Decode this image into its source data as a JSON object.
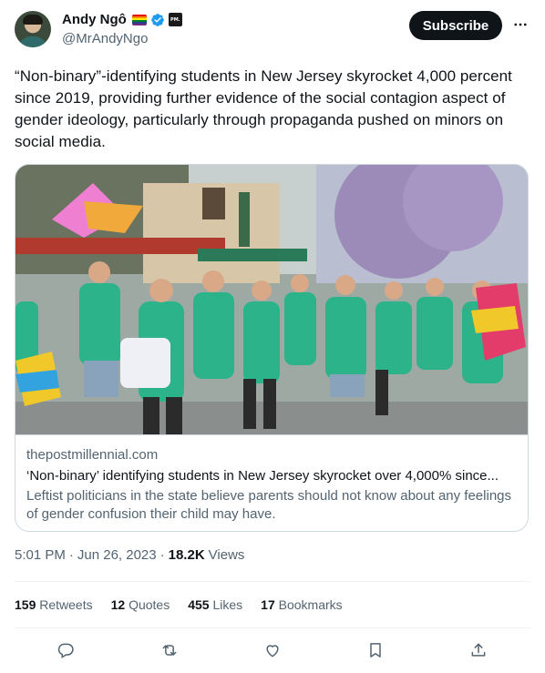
{
  "author": {
    "display_name": "Andy Ngô",
    "handle": "@MrAndyNgo",
    "badge_text": "PM."
  },
  "header": {
    "subscribe_label": "Subscribe"
  },
  "tweet": {
    "text": "“Non-binary”-identifying students in New Jersey skyrocket 4,000 percent since 2019, providing further evidence of the social contagion aspect of gender ideology, particularly through propaganda pushed on minors on social media."
  },
  "link_card": {
    "domain": "thepostmillennial.com",
    "title": "‘Non-binary’ identifying students in New Jersey skyrocket over 4,000% since...",
    "description": "Leftist politicians in the state believe parents should not know about any feelings of gender confusion their child may have."
  },
  "meta": {
    "time": "5:01 PM",
    "separator": "·",
    "date": "Jun 26, 2023",
    "views_count": "18.2K",
    "views_label": "Views"
  },
  "stats": {
    "retweets_count": "159",
    "retweets_label": "Retweets",
    "quotes_count": "12",
    "quotes_label": "Quotes",
    "likes_count": "455",
    "likes_label": "Likes",
    "bookmarks_count": "17",
    "bookmarks_label": "Bookmarks"
  },
  "icons": [
    "verified-icon",
    "more-icon",
    "reply-icon",
    "retweet-icon",
    "like-icon",
    "bookmark-icon",
    "share-icon"
  ],
  "colors": {
    "text_primary": "#0f1419",
    "text_secondary": "#536471",
    "border": "#cfd9de",
    "verified_blue": "#1d9bf0",
    "button_dark": "#0f1419"
  }
}
